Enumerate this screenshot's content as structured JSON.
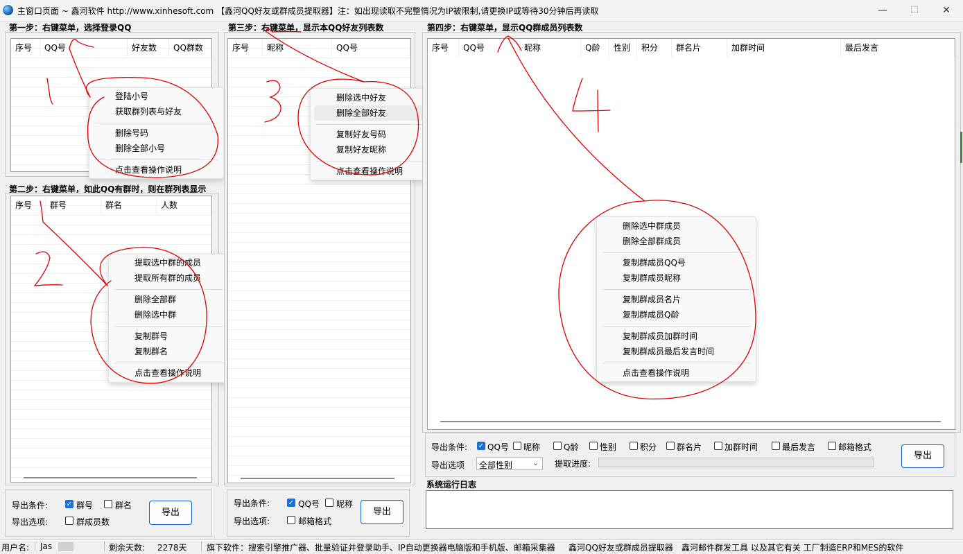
{
  "window": {
    "title": "主窗口页面 ~ 鑫河软件 http://www.xinhesoft.com 【鑫河QQ好友或群成员提取器】注：如出现读取不完整情况为IP被限制,请更换IP或等待30分钟后再读取",
    "minimize": "—",
    "maximize": "☐",
    "close": "✕"
  },
  "step1": {
    "title": "第一步：右键菜单，选择登录QQ",
    "columns": [
      "序号",
      "QQ号",
      "好友数",
      "QQ群数"
    ],
    "menu": [
      "登陆小号",
      "获取群列表与好友",
      "删除号码",
      "删除全部小号",
      "点击查看操作说明"
    ]
  },
  "step2": {
    "title": "第二步：右键菜单，如此QQ有群时，则在群列表显示",
    "columns": [
      "序号",
      "群号",
      "群名",
      "人数"
    ],
    "menu": [
      "提取选中群的成员",
      "提取所有群的成员",
      "删除全部群",
      "删除选中群",
      "复制群号",
      "复制群名",
      "点击查看操作说明"
    ],
    "export_label": "导出条件:",
    "options_label": "导出选项:",
    "checkboxes": [
      {
        "label": "群号",
        "checked": true
      },
      {
        "label": "群名",
        "checked": false
      },
      {
        "label": "群成员数",
        "checked": false
      }
    ],
    "export_button": "导出"
  },
  "step3": {
    "title": "第三步：右键菜单，显示本QQ好友列表数",
    "columns": [
      "序号",
      "昵称",
      "QQ号"
    ],
    "menu": [
      "删除选中好友",
      "删除全部好友",
      "复制好友号码",
      "复制好友昵称",
      "点击查看操作说明"
    ],
    "export_label": "导出条件:",
    "options_label": "导出选项:",
    "checkboxes": [
      {
        "label": "QQ号",
        "checked": true
      },
      {
        "label": "昵称",
        "checked": false
      },
      {
        "label": "邮箱格式",
        "checked": false
      }
    ],
    "export_button": "导出"
  },
  "step4": {
    "title": "第四步：右键菜单，显示QQ群成员列表数",
    "columns": [
      "序号",
      "QQ号",
      "昵称",
      "Q龄",
      "性别",
      "积分",
      "群名片",
      "加群时间",
      "最后发言"
    ],
    "menu": [
      "删除选中群成员",
      "删除全部群成员",
      "复制群成员QQ号",
      "复制群成员昵称",
      "复制群成员名片",
      "复制群成员Q龄",
      "复制群成员加群时间",
      "复制群成员最后发言时间",
      "点击查看操作说明"
    ],
    "export_label": "导出条件:",
    "options_label": "导出选项",
    "checkboxes": [
      {
        "label": "QQ号",
        "checked": true
      },
      {
        "label": "昵称",
        "checked": false
      },
      {
        "label": "Q龄",
        "checked": false
      },
      {
        "label": "性别",
        "checked": false
      },
      {
        "label": "积分",
        "checked": false
      },
      {
        "label": "群名片",
        "checked": false
      },
      {
        "label": "加群时间",
        "checked": false
      },
      {
        "label": "最后发言",
        "checked": false
      },
      {
        "label": "邮箱格式",
        "checked": false
      }
    ],
    "gender_select": "全部性别",
    "progress_label": "提取进度:",
    "progress": 0,
    "export_button": "导出"
  },
  "log": {
    "title": "系统运行日志"
  },
  "statusbar": {
    "user_label": "用户名:",
    "user_value": "Jas",
    "days_label": "剩余天数:",
    "days_value": "2278天",
    "products": "旗下软件：搜索引擎推广器、批量验证并登录助手、IP自动更换器电脑版和手机版、邮箱采集器",
    "product2": "鑫河QQ好友或群成员提取器",
    "product3": "鑫河邮件群发工具 以及其它有关 工厂制造ERP和MES的软件"
  },
  "annotations": [
    "1",
    "2",
    "3",
    "4"
  ]
}
